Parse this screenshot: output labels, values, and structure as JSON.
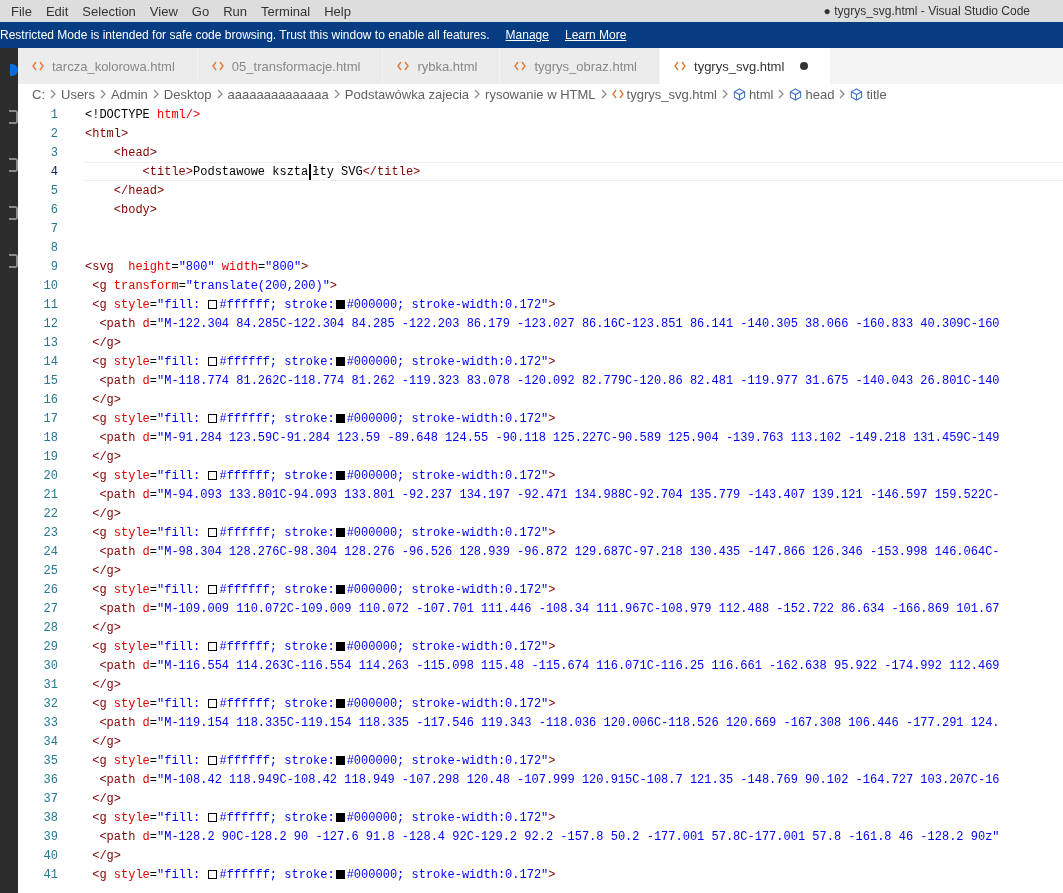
{
  "menu": [
    "File",
    "Edit",
    "Selection",
    "View",
    "Go",
    "Run",
    "Terminal",
    "Help"
  ],
  "window": {
    "title": "● tygrys_svg.html - Visual Studio Code"
  },
  "banner": {
    "text": "Restricted Mode is intended for safe code browsing. Trust this window to enable all features.",
    "links": [
      "Manage",
      "Learn More"
    ]
  },
  "tabs": [
    {
      "label": "tarcza_kolorowa.html",
      "selected": false,
      "modified": false
    },
    {
      "label": "05_transformacje.html",
      "selected": false,
      "modified": false
    },
    {
      "label": "rybka.html",
      "selected": false,
      "modified": false
    },
    {
      "label": "tygrys_obraz.html",
      "selected": false,
      "modified": false
    },
    {
      "label": "tygrys_svg.html",
      "selected": true,
      "modified": true
    }
  ],
  "breadcrumb": [
    {
      "kind": "folder",
      "label": "C:"
    },
    {
      "kind": "folder",
      "label": "Users"
    },
    {
      "kind": "folder",
      "label": "Admin"
    },
    {
      "kind": "folder",
      "label": "Desktop"
    },
    {
      "kind": "folder",
      "label": "aaaaaaaaaaaaaa"
    },
    {
      "kind": "folder",
      "label": "Podstawówka zajecia"
    },
    {
      "kind": "folder",
      "label": "rysowanie w HTML"
    },
    {
      "kind": "file",
      "label": "tygrys_svg.html"
    },
    {
      "kind": "symbol",
      "label": "html"
    },
    {
      "kind": "symbol",
      "label": "head"
    },
    {
      "kind": "symbol",
      "label": "title"
    }
  ],
  "lines": [
    {
      "n": "1",
      "current": false,
      "tokens": [
        {
          "kind": "plain",
          "t": "<!DOCTYPE "
        },
        {
          "kind": "attr",
          "t": "html/>"
        }
      ]
    },
    {
      "n": "2",
      "current": false,
      "tokens": [
        {
          "kind": "tag",
          "t": "<html>"
        }
      ]
    },
    {
      "n": "3",
      "current": false,
      "tokens": [
        {
          "kind": "tag",
          "t": "    <head>"
        }
      ]
    },
    {
      "n": "4",
      "current": true,
      "tokens": [
        {
          "kind": "tag",
          "t": "        <title>"
        },
        {
          "kind": "plain",
          "t": "Podstawowe kszta"
        },
        {
          "kind": "cursor"
        },
        {
          "kind": "plain",
          "t": "łty SVG"
        },
        {
          "kind": "tag",
          "t": "</title>"
        }
      ]
    },
    {
      "n": "5",
      "current": false,
      "tokens": [
        {
          "kind": "tag",
          "t": "    </head>"
        }
      ]
    },
    {
      "n": "6",
      "current": false,
      "tokens": [
        {
          "kind": "tag",
          "t": "    <body>"
        }
      ]
    },
    {
      "n": "7",
      "current": false
    },
    {
      "n": "8",
      "current": false
    },
    {
      "n": "9",
      "current": false,
      "tokens": [
        {
          "kind": "tag",
          "t": "<svg  "
        },
        {
          "kind": "attr",
          "t": "height"
        },
        {
          "kind": "plain",
          "t": "="
        },
        {
          "kind": "str",
          "t": "\"800\" "
        },
        {
          "kind": "attr",
          "t": "width"
        },
        {
          "kind": "plain",
          "t": "="
        },
        {
          "kind": "str",
          "t": "\"800\""
        },
        {
          "kind": "tag",
          "t": ">"
        }
      ]
    },
    {
      "n": "10",
      "current": false,
      "tokens": [
        {
          "kind": "tag",
          "t": " <g "
        },
        {
          "kind": "attr",
          "t": "transform"
        },
        {
          "kind": "plain",
          "t": "="
        },
        {
          "kind": "str",
          "t": "\"translate(200,200)\""
        },
        {
          "kind": "tag",
          "t": ">"
        }
      ]
    },
    {
      "n": "11",
      "current": false,
      "tokens": [
        {
          "kind": "tag",
          "t": " <g "
        },
        {
          "kind": "attr",
          "t": "style"
        },
        {
          "kind": "plain",
          "t": "="
        },
        {
          "kind": "str",
          "t": "\"fill: "
        },
        {
          "kind": "swatch",
          "color": "#ffffff"
        },
        {
          "kind": "str",
          "t": "#ffffff; stroke:"
        },
        {
          "kind": "swatch",
          "color": "#000000"
        },
        {
          "kind": "str",
          "t": "#000000; stroke-width:0.172\""
        },
        {
          "kind": "tag",
          "t": ">"
        }
      ]
    },
    {
      "n": "12",
      "current": false,
      "tokens": [
        {
          "kind": "tag",
          "t": "  <path "
        },
        {
          "kind": "attr",
          "t": "d"
        },
        {
          "kind": "plain",
          "t": "="
        },
        {
          "kind": "str",
          "t": "\"M-122.304 84.285C-122.304 84.285 -122.203 86.179 -123.027 86.16C-123.851 86.141 -140.305 38.066 -160.833 40.309C-160"
        }
      ]
    },
    {
      "n": "13",
      "current": false,
      "tokens": [
        {
          "kind": "tag",
          "t": " </g>"
        }
      ]
    },
    {
      "n": "14",
      "current": false,
      "tokens": [
        {
          "kind": "tag",
          "t": " <g "
        },
        {
          "kind": "attr",
          "t": "style"
        },
        {
          "kind": "plain",
          "t": "="
        },
        {
          "kind": "str",
          "t": "\"fill: "
        },
        {
          "kind": "swatch",
          "color": "#ffffff"
        },
        {
          "kind": "str",
          "t": "#ffffff; stroke:"
        },
        {
          "kind": "swatch",
          "color": "#000000"
        },
        {
          "kind": "str",
          "t": "#000000; stroke-width:0.172\""
        },
        {
          "kind": "tag",
          "t": ">"
        }
      ]
    },
    {
      "n": "15",
      "current": false,
      "tokens": [
        {
          "kind": "tag",
          "t": "  <path "
        },
        {
          "kind": "attr",
          "t": "d"
        },
        {
          "kind": "plain",
          "t": "="
        },
        {
          "kind": "str",
          "t": "\"M-118.774 81.262C-118.774 81.262 -119.323 83.078 -120.092 82.779C-120.86 82.481 -119.977 31.675 -140.043 26.801C-140"
        }
      ]
    },
    {
      "n": "16",
      "current": false,
      "tokens": [
        {
          "kind": "tag",
          "t": " </g>"
        }
      ]
    },
    {
      "n": "17",
      "current": false,
      "tokens": [
        {
          "kind": "tag",
          "t": " <g "
        },
        {
          "kind": "attr",
          "t": "style"
        },
        {
          "kind": "plain",
          "t": "="
        },
        {
          "kind": "str",
          "t": "\"fill: "
        },
        {
          "kind": "swatch",
          "color": "#ffffff"
        },
        {
          "kind": "str",
          "t": "#ffffff; stroke:"
        },
        {
          "kind": "swatch",
          "color": "#000000"
        },
        {
          "kind": "str",
          "t": "#000000; stroke-width:0.172\""
        },
        {
          "kind": "tag",
          "t": ">"
        }
      ]
    },
    {
      "n": "18",
      "current": false,
      "tokens": [
        {
          "kind": "tag",
          "t": "  <path "
        },
        {
          "kind": "attr",
          "t": "d"
        },
        {
          "kind": "plain",
          "t": "="
        },
        {
          "kind": "str",
          "t": "\"M-91.284 123.59C-91.284 123.59 -89.648 124.55 -90.118 125.227C-90.589 125.904 -139.763 113.102 -149.218 131.459C-149"
        }
      ]
    },
    {
      "n": "19",
      "current": false,
      "tokens": [
        {
          "kind": "tag",
          "t": " </g>"
        }
      ]
    },
    {
      "n": "20",
      "current": false,
      "tokens": [
        {
          "kind": "tag",
          "t": " <g "
        },
        {
          "kind": "attr",
          "t": "style"
        },
        {
          "kind": "plain",
          "t": "="
        },
        {
          "kind": "str",
          "t": "\"fill: "
        },
        {
          "kind": "swatch",
          "color": "#ffffff"
        },
        {
          "kind": "str",
          "t": "#ffffff; stroke:"
        },
        {
          "kind": "swatch",
          "color": "#000000"
        },
        {
          "kind": "str",
          "t": "#000000; stroke-width:0.172\""
        },
        {
          "kind": "tag",
          "t": ">"
        }
      ]
    },
    {
      "n": "21",
      "current": false,
      "tokens": [
        {
          "kind": "tag",
          "t": "  <path "
        },
        {
          "kind": "attr",
          "t": "d"
        },
        {
          "kind": "plain",
          "t": "="
        },
        {
          "kind": "str",
          "t": "\"M-94.093 133.801C-94.093 133.801 -92.237 134.197 -92.471 134.988C-92.704 135.779 -143.407 139.121 -146.597 159.522C-"
        }
      ]
    },
    {
      "n": "22",
      "current": false,
      "tokens": [
        {
          "kind": "tag",
          "t": " </g>"
        }
      ]
    },
    {
      "n": "23",
      "current": false,
      "tokens": [
        {
          "kind": "tag",
          "t": " <g "
        },
        {
          "kind": "attr",
          "t": "style"
        },
        {
          "kind": "plain",
          "t": "="
        },
        {
          "kind": "str",
          "t": "\"fill: "
        },
        {
          "kind": "swatch",
          "color": "#ffffff"
        },
        {
          "kind": "str",
          "t": "#ffffff; stroke:"
        },
        {
          "kind": "swatch",
          "color": "#000000"
        },
        {
          "kind": "str",
          "t": "#000000; stroke-width:0.172\""
        },
        {
          "kind": "tag",
          "t": ">"
        }
      ]
    },
    {
      "n": "24",
      "current": false,
      "tokens": [
        {
          "kind": "tag",
          "t": "  <path "
        },
        {
          "kind": "attr",
          "t": "d"
        },
        {
          "kind": "plain",
          "t": "="
        },
        {
          "kind": "str",
          "t": "\"M-98.304 128.276C-98.304 128.276 -96.526 128.939 -96.872 129.687C-97.218 130.435 -147.866 126.346 -153.998 146.064C-"
        }
      ]
    },
    {
      "n": "25",
      "current": false,
      "tokens": [
        {
          "kind": "tag",
          "t": " </g>"
        }
      ]
    },
    {
      "n": "26",
      "current": false,
      "tokens": [
        {
          "kind": "tag",
          "t": " <g "
        },
        {
          "kind": "attr",
          "t": "style"
        },
        {
          "kind": "plain",
          "t": "="
        },
        {
          "kind": "str",
          "t": "\"fill: "
        },
        {
          "kind": "swatch",
          "color": "#ffffff"
        },
        {
          "kind": "str",
          "t": "#ffffff; stroke:"
        },
        {
          "kind": "swatch",
          "color": "#000000"
        },
        {
          "kind": "str",
          "t": "#000000; stroke-width:0.172\""
        },
        {
          "kind": "tag",
          "t": ">"
        }
      ]
    },
    {
      "n": "27",
      "current": false,
      "tokens": [
        {
          "kind": "tag",
          "t": "  <path "
        },
        {
          "kind": "attr",
          "t": "d"
        },
        {
          "kind": "plain",
          "t": "="
        },
        {
          "kind": "str",
          "t": "\"M-109.009 110.072C-109.009 110.072 -107.701 111.446 -108.34 111.967C-108.979 112.488 -152.722 86.634 -166.869 101.67"
        }
      ]
    },
    {
      "n": "28",
      "current": false,
      "tokens": [
        {
          "kind": "tag",
          "t": " </g>"
        }
      ]
    },
    {
      "n": "29",
      "current": false,
      "tokens": [
        {
          "kind": "tag",
          "t": " <g "
        },
        {
          "kind": "attr",
          "t": "style"
        },
        {
          "kind": "plain",
          "t": "="
        },
        {
          "kind": "str",
          "t": "\"fill: "
        },
        {
          "kind": "swatch",
          "color": "#ffffff"
        },
        {
          "kind": "str",
          "t": "#ffffff; stroke:"
        },
        {
          "kind": "swatch",
          "color": "#000000"
        },
        {
          "kind": "str",
          "t": "#000000; stroke-width:0.172\""
        },
        {
          "kind": "tag",
          "t": ">"
        }
      ]
    },
    {
      "n": "30",
      "current": false,
      "tokens": [
        {
          "kind": "tag",
          "t": "  <path "
        },
        {
          "kind": "attr",
          "t": "d"
        },
        {
          "kind": "plain",
          "t": "="
        },
        {
          "kind": "str",
          "t": "\"M-116.554 114.263C-116.554 114.263 -115.098 115.48 -115.674 116.071C-116.25 116.661 -162.638 95.922 -174.992 112.469"
        }
      ]
    },
    {
      "n": "31",
      "current": false,
      "tokens": [
        {
          "kind": "tag",
          "t": " </g>"
        }
      ]
    },
    {
      "n": "32",
      "current": false,
      "tokens": [
        {
          "kind": "tag",
          "t": " <g "
        },
        {
          "kind": "attr",
          "t": "style"
        },
        {
          "kind": "plain",
          "t": "="
        },
        {
          "kind": "str",
          "t": "\"fill: "
        },
        {
          "kind": "swatch",
          "color": "#ffffff"
        },
        {
          "kind": "str",
          "t": "#ffffff; stroke:"
        },
        {
          "kind": "swatch",
          "color": "#000000"
        },
        {
          "kind": "str",
          "t": "#000000; stroke-width:0.172\""
        },
        {
          "kind": "tag",
          "t": ">"
        }
      ]
    },
    {
      "n": "33",
      "current": false,
      "tokens": [
        {
          "kind": "tag",
          "t": "  <path "
        },
        {
          "kind": "attr",
          "t": "d"
        },
        {
          "kind": "plain",
          "t": "="
        },
        {
          "kind": "str",
          "t": "\"M-119.154 118.335C-119.154 118.335 -117.546 119.343 -118.036 120.006C-118.526 120.669 -167.308 106.446 -177.291 124."
        }
      ]
    },
    {
      "n": "34",
      "current": false,
      "tokens": [
        {
          "kind": "tag",
          "t": " </g>"
        }
      ]
    },
    {
      "n": "35",
      "current": false,
      "tokens": [
        {
          "kind": "tag",
          "t": " <g "
        },
        {
          "kind": "attr",
          "t": "style"
        },
        {
          "kind": "plain",
          "t": "="
        },
        {
          "kind": "str",
          "t": "\"fill: "
        },
        {
          "kind": "swatch",
          "color": "#ffffff"
        },
        {
          "kind": "str",
          "t": "#ffffff; stroke:"
        },
        {
          "kind": "swatch",
          "color": "#000000"
        },
        {
          "kind": "str",
          "t": "#000000; stroke-width:0.172\""
        },
        {
          "kind": "tag",
          "t": ">"
        }
      ]
    },
    {
      "n": "36",
      "current": false,
      "tokens": [
        {
          "kind": "tag",
          "t": "  <path "
        },
        {
          "kind": "attr",
          "t": "d"
        },
        {
          "kind": "plain",
          "t": "="
        },
        {
          "kind": "str",
          "t": "\"M-108.42 118.949C-108.42 118.949 -107.298 120.48 -107.999 120.915C-108.7 121.35 -148.769 90.102 -164.727 103.207C-16"
        }
      ]
    },
    {
      "n": "37",
      "current": false,
      "tokens": [
        {
          "kind": "tag",
          "t": " </g>"
        }
      ]
    },
    {
      "n": "38",
      "current": false,
      "tokens": [
        {
          "kind": "tag",
          "t": " <g "
        },
        {
          "kind": "attr",
          "t": "style"
        },
        {
          "kind": "plain",
          "t": "="
        },
        {
          "kind": "str",
          "t": "\"fill: "
        },
        {
          "kind": "swatch",
          "color": "#ffffff"
        },
        {
          "kind": "str",
          "t": "#ffffff; stroke:"
        },
        {
          "kind": "swatch",
          "color": "#000000"
        },
        {
          "kind": "str",
          "t": "#000000; stroke-width:0.172\""
        },
        {
          "kind": "tag",
          "t": ">"
        }
      ]
    },
    {
      "n": "39",
      "current": false,
      "tokens": [
        {
          "kind": "tag",
          "t": "  <path "
        },
        {
          "kind": "attr",
          "t": "d"
        },
        {
          "kind": "plain",
          "t": "="
        },
        {
          "kind": "str",
          "t": "\"M-128.2 90C-128.2 90 -127.6 91.8 -128.4 92C-129.2 92.2 -157.8 50.2 -177.001 57.8C-177.001 57.8 -161.8 46 -128.2 90z\""
        }
      ]
    },
    {
      "n": "40",
      "current": false,
      "tokens": [
        {
          "kind": "tag",
          "t": " </g>"
        }
      ]
    },
    {
      "n": "41",
      "current": false,
      "tokens": [
        {
          "kind": "tag",
          "t": " <g "
        },
        {
          "kind": "attr",
          "t": "style"
        },
        {
          "kind": "plain",
          "t": "="
        },
        {
          "kind": "str",
          "t": "\"fill: "
        },
        {
          "kind": "swatch",
          "color": "#ffffff"
        },
        {
          "kind": "str",
          "t": "#ffffff; stroke:"
        },
        {
          "kind": "swatch",
          "color": "#000000"
        },
        {
          "kind": "str",
          "t": "#000000; stroke-width:0.172\""
        },
        {
          "kind": "tag",
          "t": ">"
        }
      ]
    }
  ]
}
